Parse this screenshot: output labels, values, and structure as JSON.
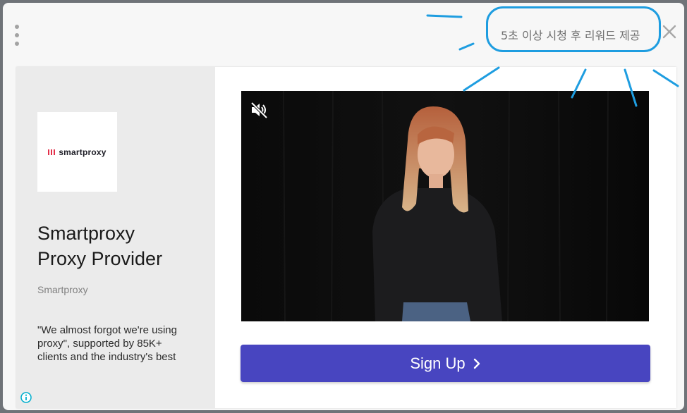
{
  "header": {
    "reward_text": "5초 이상 시청 후 리워드 제공",
    "menu_icon": "kebab-menu-icon",
    "close_icon": "close-icon"
  },
  "ad": {
    "logo_text": "smartproxy",
    "title_line1": "Smartproxy",
    "title_line2": "Proxy Provider",
    "advertiser": "Smartproxy",
    "description": "\"We almost forgot we're using proxy\", supported by 85K+ clients and the industry's best",
    "info_icon": "info-icon"
  },
  "video": {
    "mute_icon": "muted-speaker-icon"
  },
  "cta": {
    "label": "Sign Up",
    "icon": "chevron-right-icon"
  },
  "colors": {
    "cta_background": "#4845c0",
    "annotation": "#1e9de0",
    "logo_accent": "#e3304a"
  }
}
